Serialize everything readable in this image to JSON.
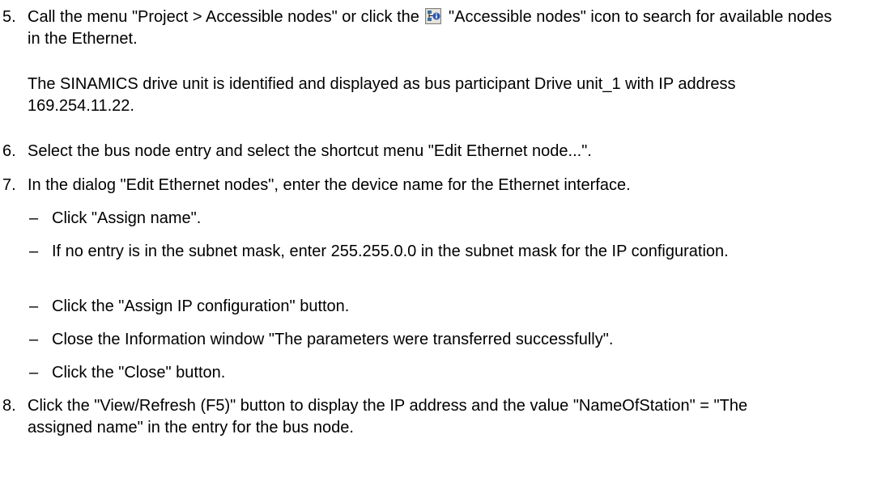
{
  "steps": [
    {
      "number": "5.",
      "text_before_icon": "Call the menu \"Project > Accessible nodes\" or click the",
      "icon": "accessible-nodes-icon",
      "text_after_icon": "\"Accessible nodes\" icon to search for available nodes in the Ethernet.",
      "note": "The SINAMICS drive unit is identified and displayed as bus participant Drive unit_1 with IP address 169.254.11.22."
    },
    {
      "number": "6.",
      "text": "Select the bus node entry and select the shortcut menu \"Edit Ethernet node...\"."
    },
    {
      "number": "7.",
      "text": "In the dialog \"Edit Ethernet nodes\", enter the device name for the Ethernet interface.",
      "substeps": [
        {
          "dash": "–",
          "text": "Click \"Assign name\"."
        },
        {
          "dash": "–",
          "text": "If no entry is in the subnet mask, enter 255.255.0.0 in the subnet mask for the IP configuration."
        },
        {
          "dash": "–",
          "text": "Click the \"Assign IP configuration\" button."
        },
        {
          "dash": "–",
          "text": "Close the Information window \"The parameters were transferred successfully\"."
        },
        {
          "dash": "–",
          "text": "Click the \"Close\" button."
        }
      ]
    },
    {
      "number": "8.",
      "text": "Click the \"View/Refresh (F5)\" button to display the IP address and the value \"NameOfStation\" = \"The assigned name\" in the entry for the bus node."
    }
  ]
}
